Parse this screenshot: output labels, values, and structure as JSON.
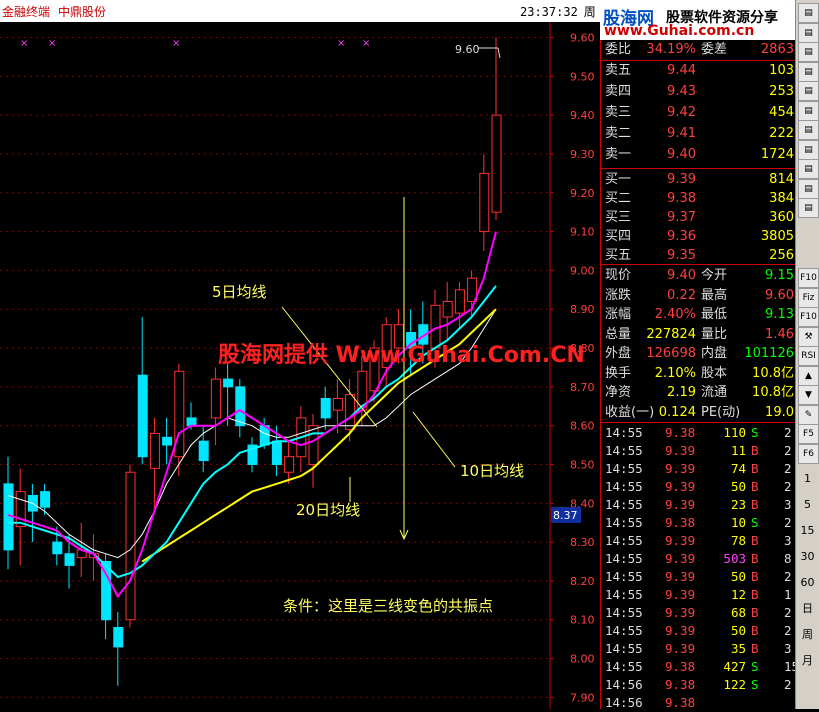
{
  "window": {
    "app_name": "金融终端",
    "stock_name": "中鼎股份",
    "clock": "23:37:32",
    "weekday": "周一"
  },
  "banner": {
    "site_name": "股海网",
    "slogan": "股票软件资源分享",
    "url": "www.Guhai.com.cn"
  },
  "chart": {
    "watermark": "股海网提供 Www.Guhai.Com.CN",
    "high_label": "9.60",
    "cursor_price": "8.37",
    "annotations": {
      "ma5": "5日均线",
      "ma10": "10日均线",
      "ma20": "20日均线",
      "condition": "条件：这里是三线变色的共振点"
    },
    "y_ticks": [
      "9.60",
      "9.50",
      "9.40",
      "9.30",
      "9.20",
      "9.10",
      "9.00",
      "8.90",
      "8.80",
      "8.70",
      "8.60",
      "8.50",
      "8.40",
      "8.30",
      "8.20",
      "8.10",
      "8.00",
      "7.90"
    ],
    "colors": {
      "up": "#ff3030",
      "down": "#00e5ff",
      "ma5": "#ff00ff",
      "ma10": "#00ffff",
      "ma20": "#ffff00",
      "ma_extra": "#ffffff"
    }
  },
  "chart_data": {
    "type": "candlestick",
    "y_range": [
      7.87,
      9.64
    ],
    "candles": [
      {
        "o": 8.45,
        "h": 8.52,
        "l": 8.23,
        "c": 8.28
      },
      {
        "o": 8.34,
        "h": 8.49,
        "l": 8.24,
        "c": 8.43
      },
      {
        "o": 8.42,
        "h": 8.45,
        "l": 8.3,
        "c": 8.38
      },
      {
        "o": 8.43,
        "h": 8.45,
        "l": 8.37,
        "c": 8.39
      },
      {
        "o": 8.3,
        "h": 8.34,
        "l": 8.24,
        "c": 8.27
      },
      {
        "o": 8.27,
        "h": 8.32,
        "l": 8.18,
        "c": 8.24
      },
      {
        "o": 8.26,
        "h": 8.35,
        "l": 8.21,
        "c": 8.28
      },
      {
        "o": 8.26,
        "h": 8.32,
        "l": 8.2,
        "c": 8.27
      },
      {
        "o": 8.25,
        "h": 8.27,
        "l": 8.05,
        "c": 8.1
      },
      {
        "o": 8.08,
        "h": 8.12,
        "l": 7.93,
        "c": 8.03
      },
      {
        "o": 8.1,
        "h": 8.5,
        "l": 8.08,
        "c": 8.48
      },
      {
        "o": 8.73,
        "h": 8.88,
        "l": 8.5,
        "c": 8.52
      },
      {
        "o": 8.49,
        "h": 8.62,
        "l": 8.38,
        "c": 8.58
      },
      {
        "o": 8.57,
        "h": 8.62,
        "l": 8.5,
        "c": 8.55
      },
      {
        "o": 8.52,
        "h": 8.76,
        "l": 8.47,
        "c": 8.74
      },
      {
        "o": 8.62,
        "h": 8.66,
        "l": 8.59,
        "c": 8.6
      },
      {
        "o": 8.56,
        "h": 8.6,
        "l": 8.48,
        "c": 8.51
      },
      {
        "o": 8.62,
        "h": 8.75,
        "l": 8.55,
        "c": 8.72
      },
      {
        "o": 8.72,
        "h": 8.76,
        "l": 8.6,
        "c": 8.7
      },
      {
        "o": 8.7,
        "h": 8.72,
        "l": 8.57,
        "c": 8.6
      },
      {
        "o": 8.55,
        "h": 8.57,
        "l": 8.48,
        "c": 8.5
      },
      {
        "o": 8.6,
        "h": 8.62,
        "l": 8.54,
        "c": 8.55
      },
      {
        "o": 8.56,
        "h": 8.6,
        "l": 8.47,
        "c": 8.5
      },
      {
        "o": 8.48,
        "h": 8.56,
        "l": 8.45,
        "c": 8.52
      },
      {
        "o": 8.52,
        "h": 8.65,
        "l": 8.48,
        "c": 8.62
      },
      {
        "o": 8.5,
        "h": 8.63,
        "l": 8.44,
        "c": 8.6
      },
      {
        "o": 8.67,
        "h": 8.7,
        "l": 8.59,
        "c": 8.62
      },
      {
        "o": 8.64,
        "h": 8.72,
        "l": 8.58,
        "c": 8.67
      },
      {
        "o": 8.59,
        "h": 8.72,
        "l": 8.56,
        "c": 8.68
      },
      {
        "o": 8.64,
        "h": 8.78,
        "l": 8.6,
        "c": 8.74
      },
      {
        "o": 8.69,
        "h": 8.82,
        "l": 8.66,
        "c": 8.8
      },
      {
        "o": 8.75,
        "h": 8.88,
        "l": 8.7,
        "c": 8.86
      },
      {
        "o": 8.8,
        "h": 8.9,
        "l": 8.76,
        "c": 8.86
      },
      {
        "o": 8.84,
        "h": 8.9,
        "l": 8.73,
        "c": 8.8
      },
      {
        "o": 8.86,
        "h": 8.92,
        "l": 8.76,
        "c": 8.81
      },
      {
        "o": 8.8,
        "h": 8.95,
        "l": 8.75,
        "c": 8.91
      },
      {
        "o": 8.88,
        "h": 8.97,
        "l": 8.82,
        "c": 8.92
      },
      {
        "o": 8.89,
        "h": 8.97,
        "l": 8.85,
        "c": 8.95
      },
      {
        "o": 8.92,
        "h": 9.0,
        "l": 8.88,
        "c": 8.98
      },
      {
        "o": 9.1,
        "h": 9.3,
        "l": 9.05,
        "c": 9.25
      },
      {
        "o": 9.15,
        "h": 9.6,
        "l": 9.13,
        "c": 9.4
      }
    ],
    "ma5": [
      8.37,
      8.36,
      8.35,
      8.34,
      8.33,
      8.3,
      8.28,
      8.27,
      8.22,
      8.16,
      8.2,
      8.28,
      8.38,
      8.48,
      8.58,
      8.6,
      8.6,
      8.6,
      8.62,
      8.64,
      8.62,
      8.6,
      8.58,
      8.56,
      8.55,
      8.56,
      8.58,
      8.6,
      8.62,
      8.64,
      8.68,
      8.74,
      8.78,
      8.81,
      8.83,
      8.85,
      8.86,
      8.88,
      8.9,
      8.98,
      9.1
    ],
    "ma10": [
      8.35,
      8.35,
      8.34,
      8.33,
      8.32,
      8.31,
      8.29,
      8.27,
      8.24,
      8.21,
      8.22,
      8.24,
      8.27,
      8.3,
      8.35,
      8.4,
      8.45,
      8.48,
      8.5,
      8.53,
      8.54,
      8.55,
      8.56,
      8.56,
      8.57,
      8.58,
      8.58,
      8.6,
      8.62,
      8.65,
      8.67,
      8.7,
      8.72,
      8.75,
      8.78,
      8.8,
      8.82,
      8.85,
      8.88,
      8.92,
      8.96
    ],
    "ma20": [
      null,
      null,
      null,
      null,
      null,
      null,
      null,
      null,
      null,
      null,
      null,
      8.25,
      8.27,
      8.29,
      8.31,
      8.33,
      8.35,
      8.37,
      8.39,
      8.41,
      8.43,
      8.44,
      8.45,
      8.46,
      8.47,
      8.49,
      8.52,
      8.55,
      8.58,
      8.62,
      8.65,
      8.68,
      8.71,
      8.73,
      8.75,
      8.77,
      8.79,
      8.81,
      8.84,
      8.87,
      8.9
    ],
    "ma_white": [
      8.42,
      8.41,
      8.4,
      8.38,
      8.35,
      8.32,
      8.3,
      8.28,
      8.27,
      8.26,
      8.28,
      8.32,
      8.38,
      8.45,
      8.5,
      8.55,
      8.58,
      8.6,
      8.62,
      8.61,
      8.6,
      8.58,
      8.57,
      8.57,
      8.58,
      8.59,
      8.6,
      8.6,
      8.6,
      8.6,
      8.6,
      8.62,
      8.65,
      8.68,
      8.7,
      8.72,
      8.74,
      8.76,
      8.8,
      8.85,
      8.9
    ]
  },
  "quote": {
    "weibi_label": "委比",
    "weibi_value": "34.19%",
    "weicha_label": "委差",
    "weicha_value": "2863",
    "asks": [
      {
        "label": "卖五",
        "price": "9.44",
        "vol": "103"
      },
      {
        "label": "卖四",
        "price": "9.43",
        "vol": "253"
      },
      {
        "label": "卖三",
        "price": "9.42",
        "vol": "454"
      },
      {
        "label": "卖二",
        "price": "9.41",
        "vol": "222"
      },
      {
        "label": "卖一",
        "price": "9.40",
        "vol": "1724"
      }
    ],
    "bids": [
      {
        "label": "买一",
        "price": "9.39",
        "vol": "814"
      },
      {
        "label": "买二",
        "price": "9.38",
        "vol": "384"
      },
      {
        "label": "买三",
        "price": "9.37",
        "vol": "360"
      },
      {
        "label": "买四",
        "price": "9.36",
        "vol": "3805"
      },
      {
        "label": "买五",
        "price": "9.35",
        "vol": "256"
      }
    ],
    "stats": [
      {
        "l1": "现价",
        "v1": "9.40",
        "l2": "今开",
        "v2": "9.15"
      },
      {
        "l1": "涨跌",
        "v1": "0.22",
        "l2": "最高",
        "v2": "9.60"
      },
      {
        "l1": "涨幅",
        "v1": "2.40%",
        "l2": "最低",
        "v2": "9.13"
      },
      {
        "l1": "总量",
        "v1": "227824",
        "l2": "量比",
        "v2": "1.46"
      },
      {
        "l1": "外盘",
        "v1": "126698",
        "l2": "内盘",
        "v2": "101126"
      },
      {
        "l1": "换手",
        "v1": "2.10%",
        "l2": "股本",
        "v2": "10.8亿"
      },
      {
        "l1": "净资",
        "v1": "2.19",
        "l2": "流通",
        "v2": "10.8亿"
      },
      {
        "l1": "收益(一)",
        "v1": "0.124",
        "l2": "PE(动)",
        "v2": "19.0"
      }
    ]
  },
  "ticks": [
    {
      "time": "14:55",
      "price": "9.38",
      "vol": "110",
      "side": "S",
      "n": "2"
    },
    {
      "time": "14:55",
      "price": "9.39",
      "vol": "11",
      "side": "B",
      "n": "2"
    },
    {
      "time": "14:55",
      "price": "9.39",
      "vol": "74",
      "side": "B",
      "n": "2"
    },
    {
      "time": "14:55",
      "price": "9.39",
      "vol": "50",
      "side": "B",
      "n": "2"
    },
    {
      "time": "14:55",
      "price": "9.39",
      "vol": "23",
      "side": "B",
      "n": "3"
    },
    {
      "time": "14:55",
      "price": "9.38",
      "vol": "10",
      "side": "S",
      "n": "2"
    },
    {
      "time": "14:55",
      "price": "9.39",
      "vol": "78",
      "side": "B",
      "n": "3"
    },
    {
      "time": "14:55",
      "price": "9.39",
      "vol": "503",
      "side": "B",
      "n": "8"
    },
    {
      "time": "14:55",
      "price": "9.39",
      "vol": "50",
      "side": "B",
      "n": "2"
    },
    {
      "time": "14:55",
      "price": "9.39",
      "vol": "12",
      "side": "B",
      "n": "1"
    },
    {
      "time": "14:55",
      "price": "9.39",
      "vol": "68",
      "side": "B",
      "n": "2"
    },
    {
      "time": "14:55",
      "price": "9.39",
      "vol": "50",
      "side": "B",
      "n": "2"
    },
    {
      "time": "14:55",
      "price": "9.39",
      "vol": "35",
      "side": "B",
      "n": "3"
    },
    {
      "time": "14:55",
      "price": "9.38",
      "vol": "427",
      "side": "S",
      "n": "15"
    },
    {
      "time": "14:56",
      "price": "9.38",
      "vol": "122",
      "side": "S",
      "n": "2"
    },
    {
      "time": "14:56",
      "price": "9.38",
      "vol": "",
      "side": "",
      "n": ""
    }
  ],
  "sidebar_buttons": [
    "1",
    "5",
    "15",
    "30",
    "60",
    "日",
    "周",
    "月"
  ]
}
